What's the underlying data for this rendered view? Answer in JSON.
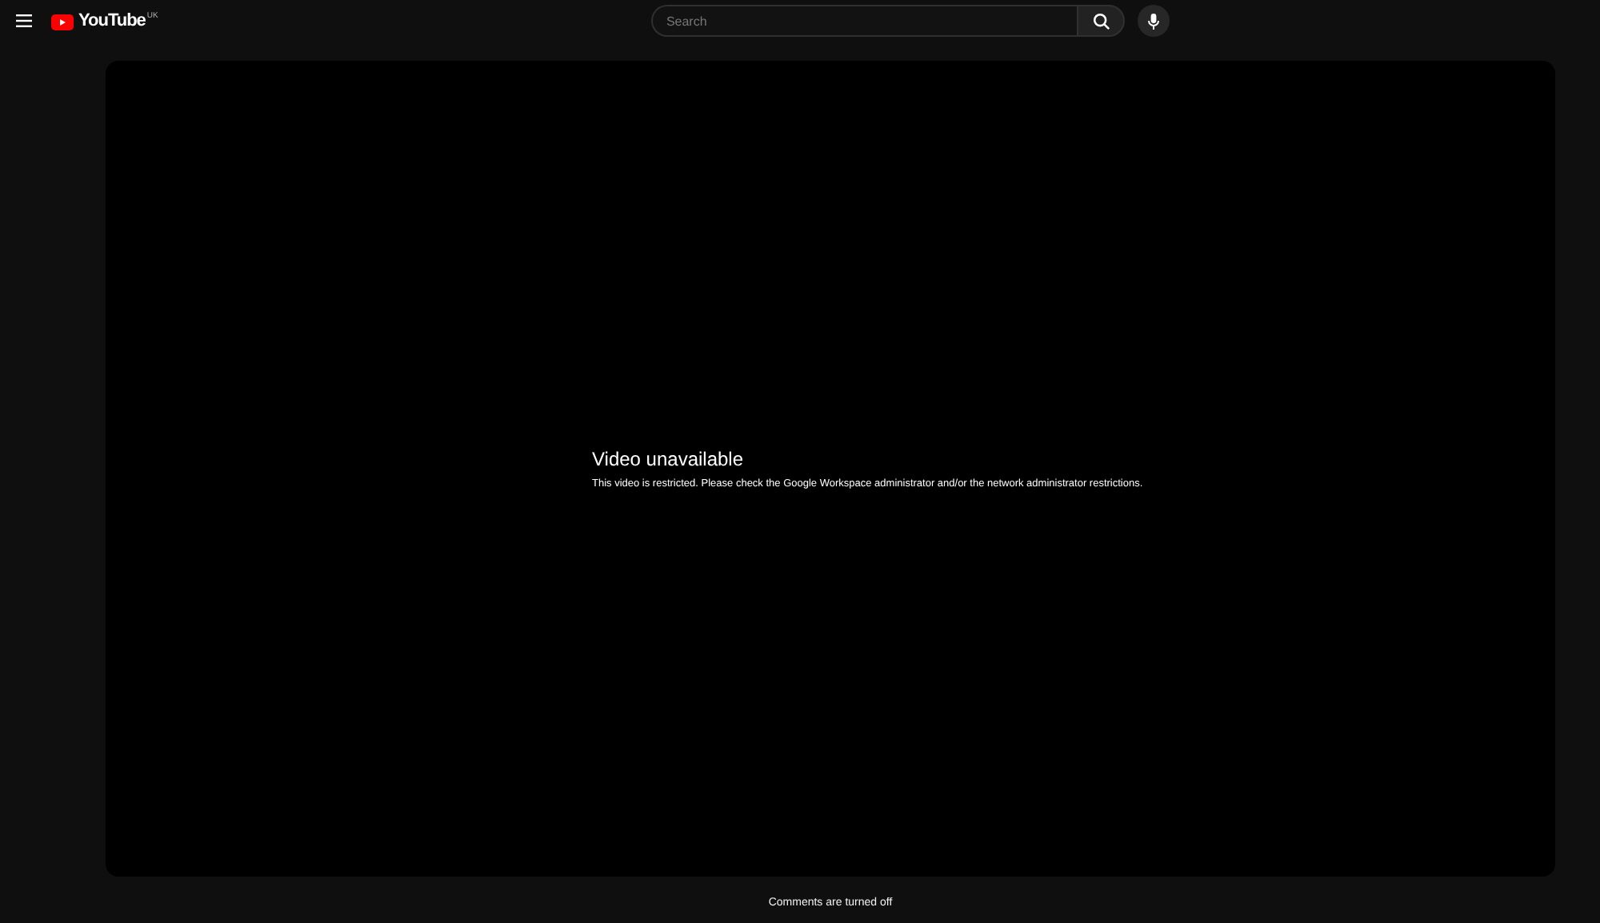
{
  "header": {
    "logo_text": "YouTube",
    "country_code": "UK",
    "search": {
      "placeholder": "Search"
    }
  },
  "player": {
    "error_title": "Video unavailable",
    "error_message": "This video is restricted. Please check the Google Workspace administrator and/or the network administrator restrictions."
  },
  "comments_notice": "Comments are turned off"
}
